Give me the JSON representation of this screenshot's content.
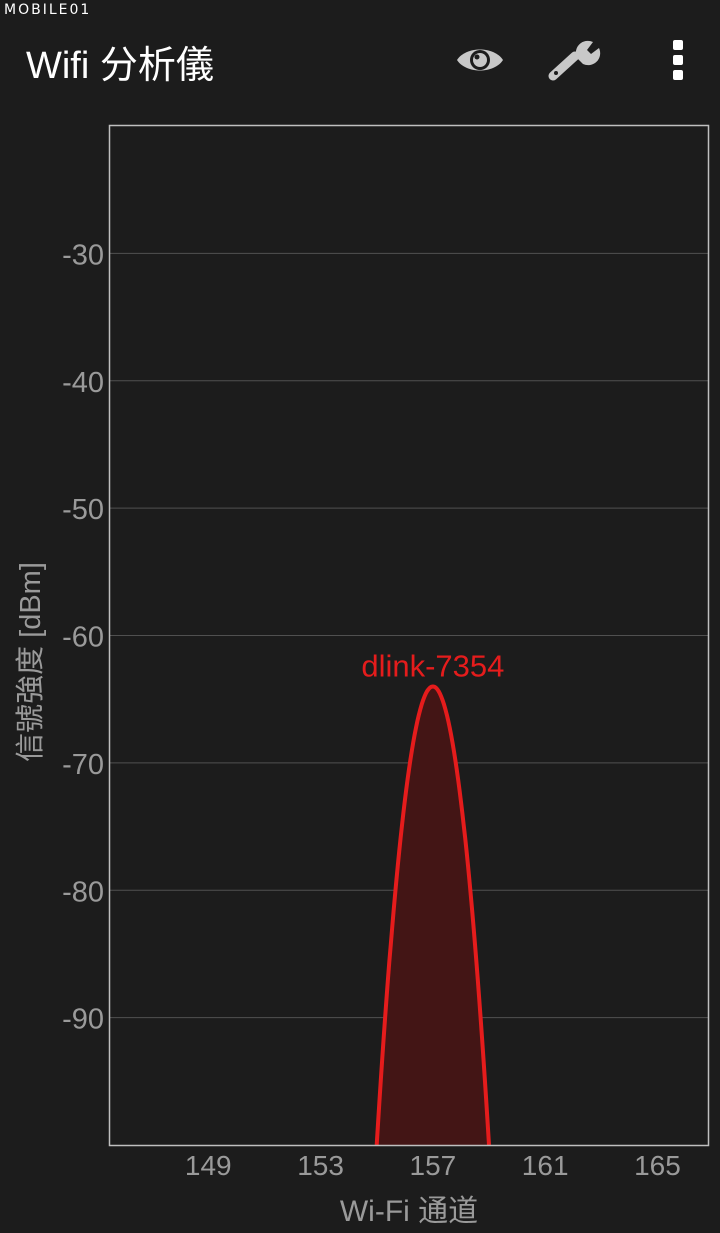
{
  "watermark": "MOBILE01",
  "appbar": {
    "title": "Wifi 分析儀",
    "actions": [
      {
        "icon": "eye-icon"
      },
      {
        "icon": "wrench-icon"
      },
      {
        "icon": "overflow-menu-icon"
      }
    ]
  },
  "colors": {
    "background": "#1c1c1c",
    "gridline": "#505050",
    "frame": "#bfbfbf",
    "tick_label": "#9a9a9a",
    "network": "#e51c1c",
    "network_fill": "#431515"
  },
  "chart_data": {
    "type": "area",
    "title": "",
    "xlabel": "Wi-Fi 通道",
    "ylabel": "信號強度 [dBm]",
    "xlim": [
      145.5,
      166.8
    ],
    "ylim": [
      -100,
      -20
    ],
    "x_ticks": [
      149,
      153,
      157,
      161,
      165
    ],
    "y_ticks": [
      -30,
      -40,
      -50,
      -60,
      -70,
      -80,
      -90
    ],
    "grid": true,
    "series": [
      {
        "name": "dlink-7354",
        "channel": 157,
        "peak_dbm": -64,
        "x_range": [
          155,
          159
        ]
      }
    ]
  }
}
